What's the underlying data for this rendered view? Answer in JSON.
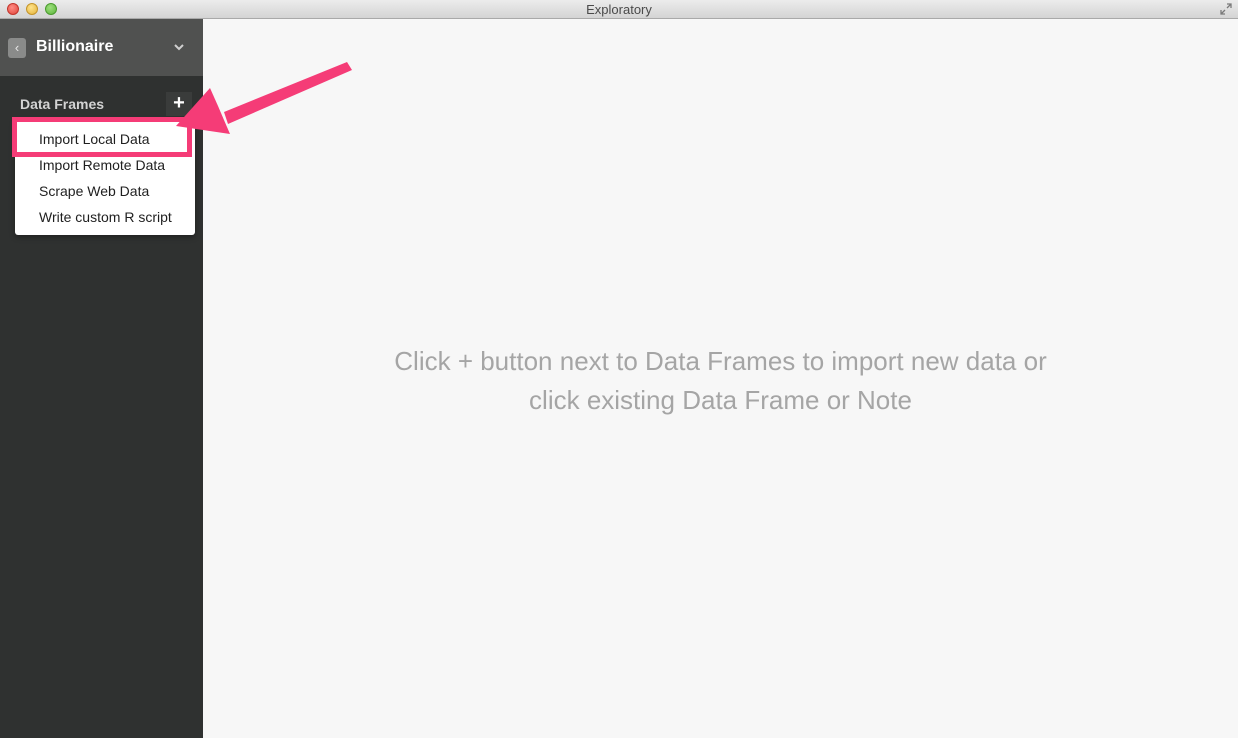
{
  "window": {
    "title": "Exploratory"
  },
  "sidebar": {
    "project_title": "Billionaire",
    "back_label": "‹",
    "section_label": "Data Frames",
    "add_label": "+"
  },
  "menu": {
    "items": [
      {
        "label": "Import Local Data"
      },
      {
        "label": "Import Remote Data"
      },
      {
        "label": "Scrape Web Data"
      },
      {
        "label": "Write custom R script"
      }
    ]
  },
  "main": {
    "empty_message": "Click + button next to Data Frames to import new data or click existing Data Frame or Note"
  },
  "colors": {
    "sidebar_bg": "#2f3130",
    "header_bg": "#505150",
    "annotation_pink": "#f53c77",
    "message_gray": "#a5a5a5"
  },
  "icons": {
    "close": "close-button-icon",
    "minimize": "minimize-button-icon",
    "maximize": "zoom-button-icon",
    "fullscreen": "fullscreen-arrows-icon",
    "dropdown": "chevron-down-icon",
    "back": "chevron-left-icon",
    "annotation": "arrow-annotation-icon"
  }
}
